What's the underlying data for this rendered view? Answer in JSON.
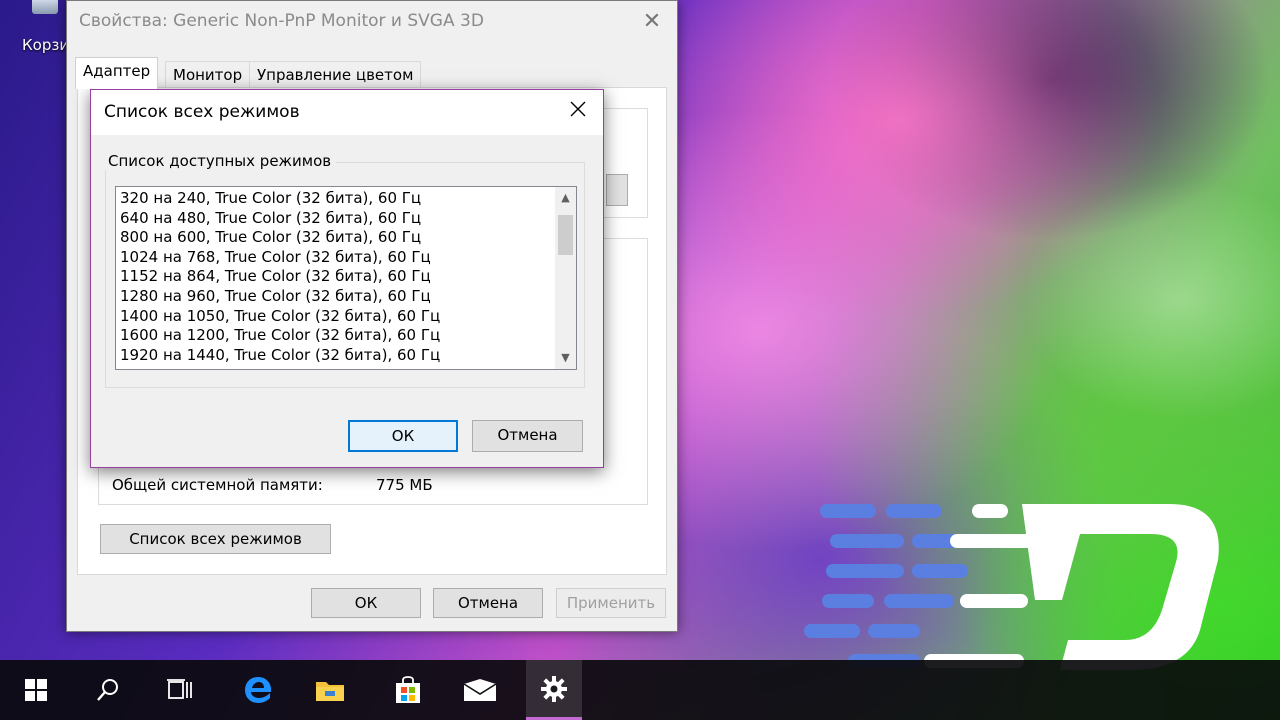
{
  "desktop": {
    "recycle_label": "Корзи"
  },
  "window": {
    "title": "Свойства: Generic Non-PnP Monitor и SVGA 3D",
    "tabs": [
      {
        "label": "Адаптер",
        "active": true
      },
      {
        "label": "Монитор"
      },
      {
        "label": "Управление цветом"
      }
    ],
    "memory": {
      "label": "Общей системной памяти:",
      "value": "775 МБ"
    },
    "list_all_modes_button": "Список всех режимов",
    "ok_button": "ОК",
    "cancel_button": "Отмена",
    "apply_button": "Применить"
  },
  "modal": {
    "title": "Список всех режимов",
    "group_label": "Список доступных режимов",
    "modes": [
      "320 на 240, True Color (32 бита), 60 Гц",
      "640 на 480, True Color (32 бита), 60 Гц",
      "800 на 600, True Color (32 бита), 60 Гц",
      "1024 на 768, True Color (32 бита), 60 Гц",
      "1152 на 864, True Color (32 бита), 60 Гц",
      "1280 на 960, True Color (32 бита), 60 Гц",
      "1400 на 1050, True Color (32 бита), 60 Гц",
      "1600 на 1200, True Color (32 бита), 60 Гц",
      "1920 на 1440, True Color (32 бита), 60 Гц"
    ],
    "ok_button": "ОК",
    "cancel_button": "Отмена"
  },
  "taskbar": {
    "items": [
      "windows-start-icon",
      "search-icon",
      "task-view-icon",
      "edge-icon",
      "file-explorer-icon",
      "store-icon",
      "mail-icon",
      "settings-icon"
    ],
    "active": "settings-icon"
  },
  "colors": {
    "accent": "#0078d7",
    "modal_border": "#9a3fa2",
    "taskbar_active": "#c36bd3"
  }
}
